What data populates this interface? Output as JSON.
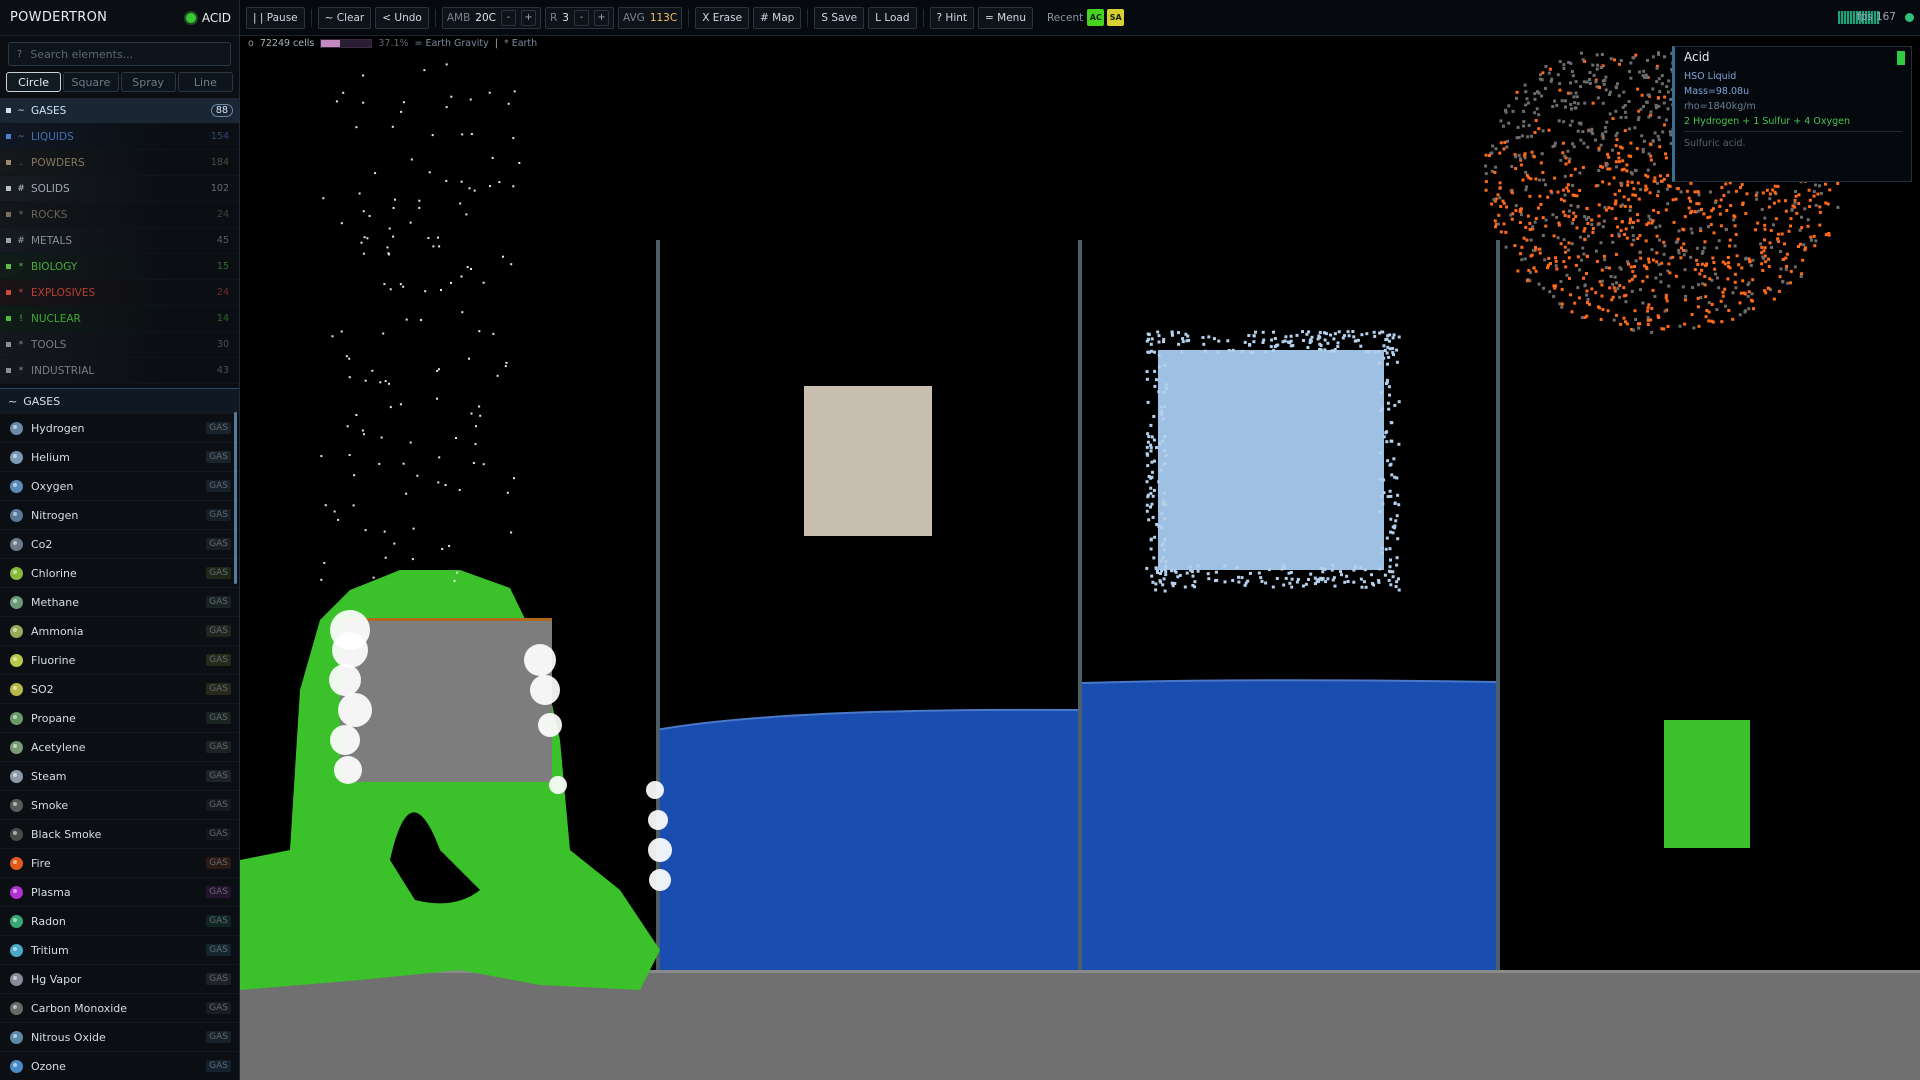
{
  "app": {
    "title": "POWDERTRON",
    "selected_element": "ACID"
  },
  "search": {
    "glyph": "?",
    "placeholder": "Search elements..."
  },
  "brushes": [
    {
      "label": "Circle",
      "active": true
    },
    {
      "label": "Square",
      "active": false
    },
    {
      "label": "Spray",
      "active": false
    },
    {
      "label": "Line",
      "active": false
    }
  ],
  "categories": [
    {
      "glyph": "~",
      "label": "GASES",
      "count": "88",
      "color": "#cfe3f5",
      "active": true
    },
    {
      "glyph": "~",
      "label": "LIQUIDS",
      "count": "154",
      "color": "#4f7fd0",
      "active": false
    },
    {
      "glyph": ".",
      "label": "POWDERS",
      "count": "184",
      "color": "#9a8a6a",
      "active": false
    },
    {
      "glyph": "#",
      "label": "SOLIDS",
      "count": "102",
      "color": "#b8c2cc",
      "active": false
    },
    {
      "glyph": "*",
      "label": "ROCKS",
      "count": "24",
      "color": "#7a7060",
      "active": false
    },
    {
      "glyph": "#",
      "label": "METALS",
      "count": "45",
      "color": "#9aa4b0",
      "active": false
    },
    {
      "glyph": "*",
      "label": "BIOLOGY",
      "count": "15",
      "color": "#58c048",
      "active": false
    },
    {
      "glyph": "*",
      "label": "EXPLOSIVES",
      "count": "24",
      "color": "#d04838",
      "active": false
    },
    {
      "glyph": "!",
      "label": "NUCLEAR",
      "count": "14",
      "color": "#48c038",
      "active": false
    },
    {
      "glyph": "*",
      "label": "TOOLS",
      "count": "30",
      "color": "#8a8f95",
      "active": false
    },
    {
      "glyph": "*",
      "label": "INDUSTRIAL",
      "count": "43",
      "color": "#8a9096",
      "active": false
    }
  ],
  "gas_section": {
    "glyph": "~",
    "label": "GASES"
  },
  "elements": [
    {
      "name": "Hydrogen",
      "tag": "GAS",
      "color": "#6a8aa8"
    },
    {
      "name": "Helium",
      "tag": "GAS",
      "color": "#7a9ab8"
    },
    {
      "name": "Oxygen",
      "tag": "GAS",
      "color": "#5a8ab8"
    },
    {
      "name": "Nitrogen",
      "tag": "GAS",
      "color": "#5a7898"
    },
    {
      "name": "Co2",
      "tag": "GAS",
      "color": "#6a7a88"
    },
    {
      "name": "Chlorine",
      "tag": "GAS",
      "color": "#8ab838"
    },
    {
      "name": "Methane",
      "tag": "GAS",
      "color": "#6a9a78"
    },
    {
      "name": "Ammonia",
      "tag": "GAS",
      "color": "#9aa858"
    },
    {
      "name": "Fluorine",
      "tag": "GAS",
      "color": "#b8c848"
    },
    {
      "name": "SO2",
      "tag": "GAS",
      "color": "#b8b848"
    },
    {
      "name": "Propane",
      "tag": "GAS",
      "color": "#6a9a68"
    },
    {
      "name": "Acetylene",
      "tag": "GAS",
      "color": "#7a9a78"
    },
    {
      "name": "Steam",
      "tag": "GAS",
      "color": "#8a9aa8"
    },
    {
      "name": "Smoke",
      "tag": "GAS",
      "color": "#5a5a5a"
    },
    {
      "name": "Black Smoke",
      "tag": "GAS",
      "color": "#4a4a4a"
    },
    {
      "name": "Fire",
      "tag": "GAS",
      "color": "#e05a1a"
    },
    {
      "name": "Plasma",
      "tag": "GAS",
      "color": "#b030d0"
    },
    {
      "name": "Radon",
      "tag": "GAS",
      "color": "#38a878"
    },
    {
      "name": "Tritium",
      "tag": "GAS",
      "color": "#4aa8c8"
    },
    {
      "name": "Hg Vapor",
      "tag": "GAS",
      "color": "#8a8a98"
    },
    {
      "name": "Carbon Monoxide",
      "tag": "GAS",
      "color": "#6a6a6a"
    },
    {
      "name": "Nitrous Oxide",
      "tag": "GAS",
      "color": "#5a8aa8"
    },
    {
      "name": "Ozone",
      "tag": "GAS",
      "color": "#4a8ac8"
    }
  ],
  "toolbar": {
    "pause": "| | Pause",
    "clear": "~ Clear",
    "undo": "< Undo",
    "amb_label": "AMB",
    "amb_value": "20C",
    "minus": "-",
    "plus": "+",
    "radius_label": "R",
    "radius_value": "3",
    "avg_label": "AVG",
    "avg_value": "113C",
    "erase": "X Erase",
    "map": "# Map",
    "save": "S Save",
    "load": "L Load",
    "hint": "? Hint",
    "menu": "= Menu",
    "recent_label": "Recent",
    "recent": [
      {
        "label": "AC",
        "color": "#46d41e"
      },
      {
        "label": "SA",
        "color": "#d8d030"
      }
    ],
    "fps": "fps 167"
  },
  "status": {
    "prefix": "o",
    "cells": "72249 cells",
    "mass_fraction": 0.37,
    "mass_pct": "37.1%",
    "gravity_mode": "= Earth Gravity",
    "separator": "|",
    "world": "* Earth"
  },
  "info_panel": {
    "name": "Acid",
    "formula_state": "HSO  Liquid",
    "mass": "Mass=98.08u",
    "density": "rho=1840kg/m",
    "recipe": "2 Hydrogen + 1 Sulfur + 4 Oxygen",
    "description": "Sulfuric acid."
  },
  "colors": {
    "water": "#1a4db0",
    "acid_green": "#3bc12a",
    "stone": "#7d7d7d",
    "floor": "#707070",
    "sand_block": "#c8bfb0",
    "ice_block": "#9ec0e2",
    "fire_orange": "#ff6a1a",
    "wall": "#4e5e68"
  }
}
